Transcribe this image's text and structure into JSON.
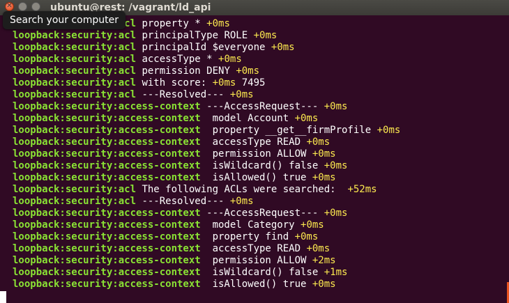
{
  "window": {
    "title": "ubuntu@rest: /vagrant/ld_api"
  },
  "tooltip": {
    "text": "Search your computer"
  },
  "colors": {
    "background": "#300a24",
    "namespace": "#8ae234",
    "timing": "#fce94f",
    "text": "#ffffff",
    "accent": "#e95420"
  },
  "lines": [
    {
      "ns": "loopback:security:acl",
      "msg": " property * ",
      "ms": "+0ms"
    },
    {
      "ns": "loopback:security:acl",
      "msg": " principalType ROLE ",
      "ms": "+0ms"
    },
    {
      "ns": "loopback:security:acl",
      "msg": " principalId $everyone ",
      "ms": "+0ms"
    },
    {
      "ns": "loopback:security:acl",
      "msg": " accessType * ",
      "ms": "+0ms"
    },
    {
      "ns": "loopback:security:acl",
      "msg": " permission DENY ",
      "ms": "+0ms"
    },
    {
      "ns": "loopback:security:acl",
      "msg": " with score: ",
      "ms": "+0ms",
      "tail": " 7495"
    },
    {
      "ns": "loopback:security:acl",
      "msg": " ---Resolved--- ",
      "ms": "+0ms"
    },
    {
      "ns": "loopback:security:access-context",
      "msg": " ---AccessRequest--- ",
      "ms": "+0ms"
    },
    {
      "ns": "loopback:security:access-context",
      "msg": "  model Account ",
      "ms": "+0ms"
    },
    {
      "ns": "loopback:security:access-context",
      "msg": "  property __get__firmProfile ",
      "ms": "+0ms"
    },
    {
      "ns": "loopback:security:access-context",
      "msg": "  accessType READ ",
      "ms": "+0ms"
    },
    {
      "ns": "loopback:security:access-context",
      "msg": "  permission ALLOW ",
      "ms": "+0ms"
    },
    {
      "ns": "loopback:security:access-context",
      "msg": "  isWildcard() false ",
      "ms": "+0ms"
    },
    {
      "ns": "loopback:security:access-context",
      "msg": "  isAllowed() true ",
      "ms": "+0ms"
    },
    {
      "ns": "loopback:security:acl",
      "msg": " The following ACLs were searched:  ",
      "ms": "+52ms"
    },
    {
      "ns": "loopback:security:acl",
      "msg": " ---Resolved--- ",
      "ms": "+0ms"
    },
    {
      "ns": "loopback:security:access-context",
      "msg": " ---AccessRequest--- ",
      "ms": "+0ms"
    },
    {
      "ns": "loopback:security:access-context",
      "msg": "  model Category ",
      "ms": "+0ms"
    },
    {
      "ns": "loopback:security:access-context",
      "msg": "  property find ",
      "ms": "+0ms"
    },
    {
      "ns": "loopback:security:access-context",
      "msg": "  accessType READ ",
      "ms": "+0ms"
    },
    {
      "ns": "loopback:security:access-context",
      "msg": "  permission ALLOW ",
      "ms": "+2ms"
    },
    {
      "ns": "loopback:security:access-context",
      "msg": "  isWildcard() false ",
      "ms": "+1ms"
    },
    {
      "ns": "loopback:security:access-context",
      "msg": "  isAllowed() true ",
      "ms": "+0ms"
    }
  ]
}
